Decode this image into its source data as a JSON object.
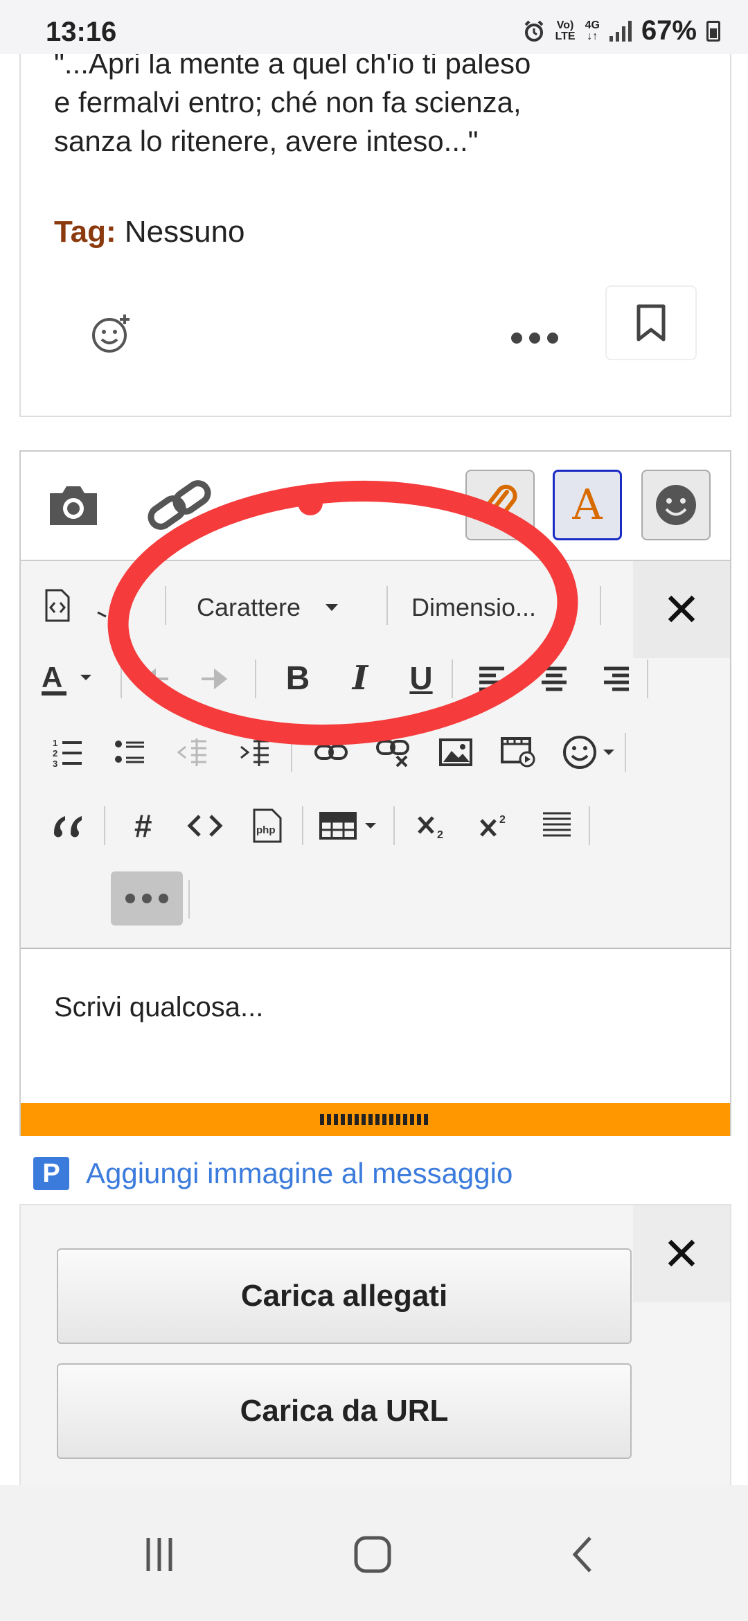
{
  "status_bar": {
    "time": "13:16",
    "network_top": "Vo)",
    "network_bottom": "LTE",
    "data_type": "4G",
    "battery": "67%"
  },
  "post": {
    "quote_lines": [
      "\"...Apri la mente a quel ch'io ti paleso",
      "e fermalvi entro; ché non fa scienza,",
      "sanza lo ritenere, avere inteso...\""
    ],
    "tag_label": "Tag:",
    "tag_value": "Nessuno"
  },
  "editor": {
    "font_dropdown": "Carattere",
    "size_dropdown": "Dimensio...",
    "placeholder": "Scrivi qualcosa...",
    "bold": "B",
    "italic": "I",
    "underline": "U",
    "format_button": "A"
  },
  "add_image": {
    "badge": "P",
    "label": "Aggiungi immagine al messaggio"
  },
  "attachments": {
    "upload_label": "Carica allegati",
    "url_label": "Carica da URL"
  },
  "colors": {
    "accent_orange": "#ff9800",
    "link_blue": "#3b7bdc",
    "tag_brown": "#8b3a0e",
    "annotation_red": "#f53b3b"
  }
}
